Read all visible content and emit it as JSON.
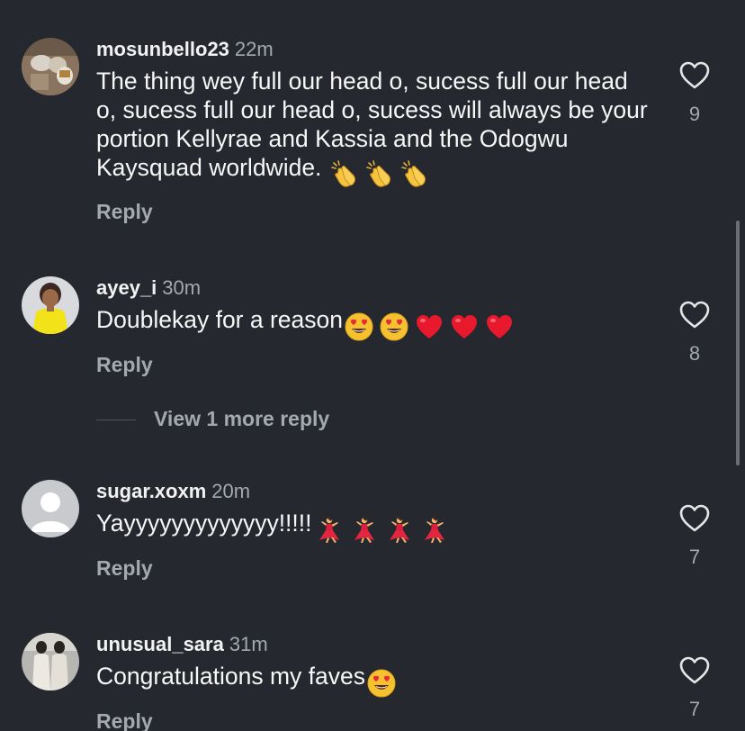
{
  "comments": [
    {
      "username": "mosunbello23",
      "time": "22m",
      "text": "The thing wey full our head o, sucess full our head o, sucess full our head o, sucess will always be your portion Kellyrae and Kassia and the Odogwu Kaysquad worldwide.",
      "emojis": [
        "clapping-hands",
        "clapping-hands",
        "clapping-hands"
      ],
      "reply_label": "Reply",
      "likes": "9"
    },
    {
      "username": "ayey_i",
      "time": "30m",
      "text": "Doublekay for a reason",
      "emojis": [
        "heart-eyes",
        "heart-eyes",
        "red-heart",
        "red-heart",
        "red-heart"
      ],
      "reply_label": "Reply",
      "likes": "8",
      "view_more": "View 1 more reply"
    },
    {
      "username": "sugar.xoxm",
      "time": "20m",
      "text": "Yayyyyyyyyyyyyy!!!!!",
      "emojis": [
        "dancer",
        "dancer",
        "dancer",
        "dancer"
      ],
      "reply_label": "Reply",
      "likes": "7"
    },
    {
      "username": "unusual_sara",
      "time": "31m",
      "text": "Congratulations my faves",
      "emojis": [
        "heart-eyes"
      ],
      "reply_label": "Reply",
      "likes": "7"
    }
  ],
  "colors": {
    "background": "#25282f",
    "secondary_text": "#a4a8b0",
    "primary_text": "#f7f7f7"
  }
}
